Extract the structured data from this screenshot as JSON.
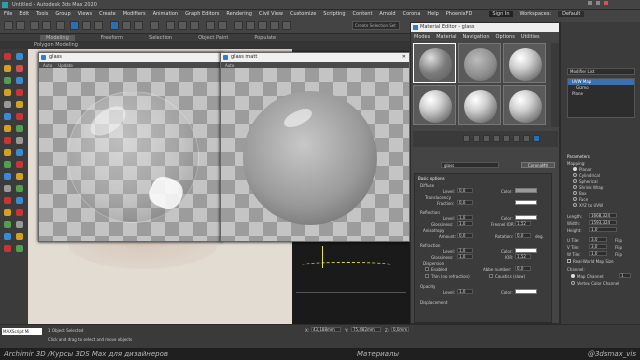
{
  "app": {
    "window_title": "Untitled - Autodesk 3ds Max 2020",
    "sign_in": "Sign In",
    "workspaces_label": "Workspaces:",
    "workspaces_value": "Default",
    "search_placeholder": "Create Selection Set"
  },
  "menu": [
    "File",
    "Edit",
    "Tools",
    "Group",
    "Views",
    "Create",
    "Modifiers",
    "Animation",
    "Graph Editors",
    "Rendering",
    "Civil View",
    "Customize",
    "Scripting",
    "Content",
    "Arnold",
    "Corona",
    "Help",
    "PhoenixFD"
  ],
  "ribbon": {
    "tabs": [
      "Modeling",
      "Freeform",
      "Selection",
      "Object Paint",
      "Populate"
    ],
    "active": "Modeling",
    "sub": "Polygon Modeling"
  },
  "vfb_left": {
    "title": "glass",
    "toolbar": [
      "Auto",
      "Update"
    ]
  },
  "vfb_right": {
    "title": "glass matt",
    "toolbar": [
      "Auto"
    ]
  },
  "material_editor": {
    "title": "Material Editor - glass",
    "menu": [
      "Modes",
      "Material",
      "Navigation",
      "Options",
      "Utilities"
    ],
    "slot_count": 6,
    "material_name": "glass",
    "material_type": "CoronaMtl",
    "rollout_title": "Basic options",
    "diffuse": {
      "section": "Diffuse",
      "level_label": "Level:",
      "level": "0,0",
      "color_label": "Color:",
      "translucency": "Translucency",
      "fraction_label": "Fraction:",
      "fraction": "0,0"
    },
    "reflection": {
      "section": "Reflection",
      "level_label": "Level:",
      "level": "1,0",
      "color_label": "Color:",
      "glossiness_label": "Glossiness:",
      "glossiness": "1,0",
      "fresnel_label": "Fresnel IOR:",
      "fresnel": "1,52",
      "anisotropy": "Anisotropy",
      "amount_label": "Amount:",
      "amount": "0,0",
      "rotation_label": "Rotation:",
      "rotation": "0,0",
      "deg": "deg."
    },
    "refraction": {
      "section": "Refraction",
      "level_label": "Level:",
      "level": "1,0",
      "color_label": "Color:",
      "glossiness_label": "Glossiness:",
      "glossiness": "1,0",
      "ior_label": "IOR:",
      "ior": "1,52",
      "dispersion": "Dispersion",
      "enabled": "Enabled",
      "abbe_label": "Abbe number:",
      "abbe": "0,0",
      "thin": "Thin (no refraction)",
      "caustics": "Caustics (slow)"
    },
    "opacity": {
      "section": "Opacity",
      "level_label": "Level:",
      "level": "1,0",
      "color_label": "Color:"
    },
    "displacement": "Displacement"
  },
  "right_panel": {
    "modifier_list": "Modifier List",
    "stack": [
      "UVW Map",
      "Gizmo",
      "Plane"
    ],
    "params_title": "Parameters",
    "mapping_label": "Mapping:",
    "mapping_options": [
      "Planar",
      "Cylindrical",
      "Spherical",
      "Shrink Wrap",
      "Box",
      "Face",
      "XYZ to UVW"
    ],
    "mapping_selected": "Planar",
    "length_label": "Length:",
    "length": "1668,324",
    "width_label": "Width:",
    "width": "1593,324",
    "height_label": "Height:",
    "height": "1,0",
    "utile_label": "U Tile:",
    "utile": "3,0",
    "vtile_label": "V Tile:",
    "vtile": "3,0",
    "wtile_label": "W Tile:",
    "wtile": "1,0",
    "flip": "Flip",
    "real_world": "Real-World Map Size",
    "channel_label": "Channel:",
    "map_channel": "Map Channel:",
    "map_channel_value": "1",
    "vertex_color": "Vertex Color Channel"
  },
  "status": {
    "selected": "1 Object Selected",
    "hint": "Click and drag to select and move objects",
    "maxscript": "MAXScript Mi",
    "x_label": "X:",
    "x": "43,188mm",
    "y_label": "Y:",
    "y": "75,482mm",
    "z_label": "Z:",
    "z": "0,0mm"
  },
  "watermark": {
    "left": "Archimir 3D /Курсы 3DS Max для дизайнеров",
    "center": "Материалы",
    "right": "@3dsmax_vis"
  },
  "colors": {
    "accent": "#2a7fd4",
    "panel": "#444444",
    "dark": "#2d2d2d"
  }
}
